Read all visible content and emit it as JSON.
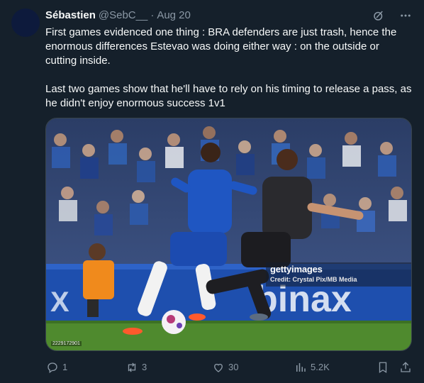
{
  "tweet": {
    "author_name": "Sébastien",
    "handle": "@SebC__",
    "separator": "·",
    "time": "Aug 20",
    "text_paragraphs": [
      "First games evidenced one thing : BRA defenders are just trash, hence the enormous differences Estevao was doing either way : on the outside or cutting inside.",
      "Last two games show that he'll have to rely on his timing to release a pass, as he didn't enjoy enormous success 1v1"
    ],
    "media": {
      "watermark": "gettyimages",
      "credit": "Credit: Crystal Pix/MB Media",
      "image_id": "2229172901",
      "board_text": "binax"
    },
    "actions": {
      "replies": "1",
      "retweets": "3",
      "likes": "30",
      "views": "5.2K"
    }
  },
  "icons": {
    "grok": "grok-icon",
    "more": "more-icon",
    "reply": "reply-icon",
    "retweet": "retweet-icon",
    "like": "heart-icon",
    "views": "views-icon",
    "bookmark": "bookmark-icon",
    "share": "share-icon"
  },
  "colors": {
    "background": "#15202b",
    "text": "#f7f9f9",
    "secondary": "#8b98a5",
    "border": "#38444d"
  }
}
